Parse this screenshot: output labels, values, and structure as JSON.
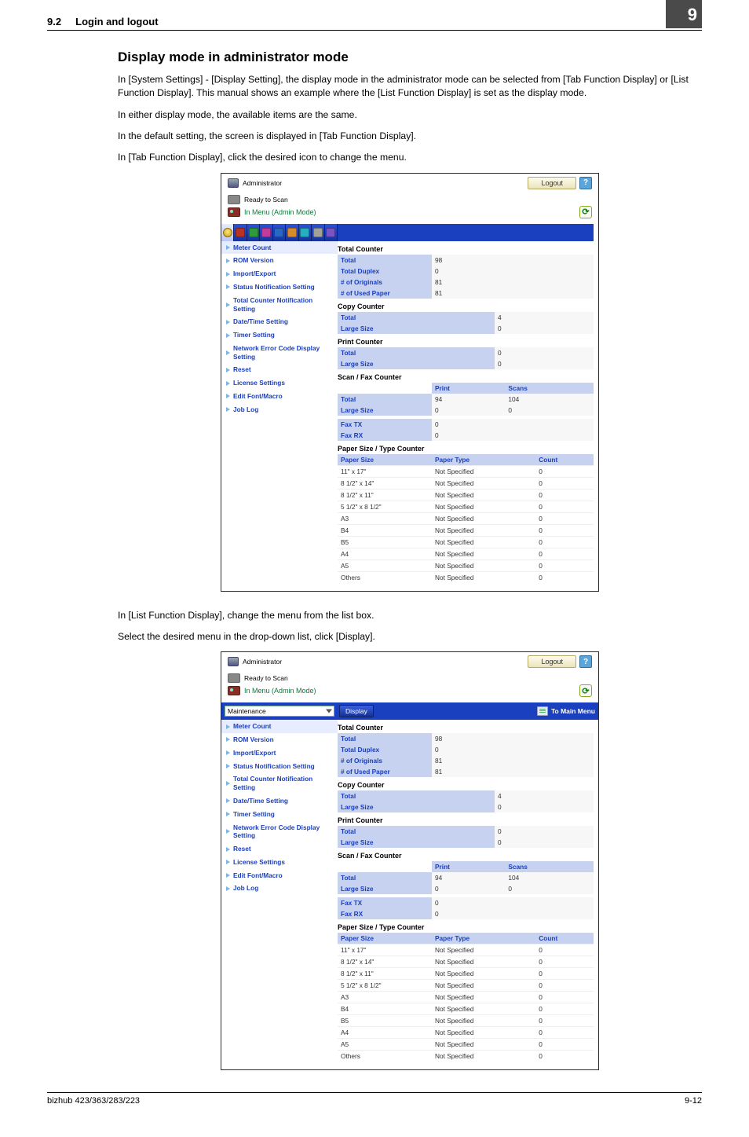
{
  "section": {
    "number": "9.2",
    "title": "Login and logout",
    "chapter": "9"
  },
  "h2": "Display mode in administrator mode",
  "paragraphs": {
    "p1": "In [System Settings] - [Display Setting], the display mode in the administrator mode can be selected from [Tab Function Display] or [List Function Display]. This manual shows an example where the [List Function Display] is set as the display mode.",
    "p2": "In either display mode, the available items are the same.",
    "p3": "In the default setting, the screen is displayed in [Tab Function Display].",
    "p4": "In [Tab Function Display], click the desired icon to change the menu.",
    "p5": "In [List Function Display], change the menu from the list box.",
    "p6": "Select the desired menu in the drop-down list, click [Display]."
  },
  "screenshot_common": {
    "admin_label": "Administrator",
    "logout": "Logout",
    "help": "?",
    "ready": "Ready to Scan",
    "menu_mode": "In Menu (Admin Mode)",
    "sidebar": [
      "Meter Count",
      "ROM Version",
      "Import/Export",
      "Status Notification Setting",
      "Total Counter Notification Setting",
      "Date/Time Setting",
      "Timer Setting",
      "Network Error Code Display Setting",
      "Reset",
      "License Settings",
      "Edit Font/Macro",
      "Job Log"
    ],
    "sections": {
      "total_counter_title": "Total Counter",
      "total_counter": [
        [
          "Total",
          "98"
        ],
        [
          "Total Duplex",
          "0"
        ],
        [
          "# of Originals",
          "81"
        ],
        [
          "# of Used Paper",
          "81"
        ]
      ],
      "copy_counter_title": "Copy Counter",
      "copy_counter": [
        [
          "Total",
          "4"
        ],
        [
          "Large Size",
          "0"
        ]
      ],
      "print_counter_title": "Print Counter",
      "print_counter": [
        [
          "Total",
          "0"
        ],
        [
          "Large Size",
          "0"
        ]
      ],
      "scan_fax_title": "Scan / Fax Counter",
      "scan_fax_headers": [
        "",
        "Print",
        "Scans"
      ],
      "scan_fax_rows": [
        [
          "Total",
          "94",
          "104"
        ],
        [
          "Large Size",
          "0",
          "0"
        ]
      ],
      "fax_rows": [
        [
          "Fax TX",
          "0"
        ],
        [
          "Fax RX",
          "0"
        ]
      ],
      "paper_title": "Paper Size / Type Counter",
      "paper_headers": [
        "Paper Size",
        "Paper Type",
        "Count"
      ],
      "paper_rows": [
        [
          "11\" x 17\"",
          "Not Specified",
          "0"
        ],
        [
          "8 1/2\" x 14\"",
          "Not Specified",
          "0"
        ],
        [
          "8 1/2\" x 11\"",
          "Not Specified",
          "0"
        ],
        [
          "5 1/2\" x 8 1/2\"",
          "Not Specified",
          "0"
        ],
        [
          "A3",
          "Not Specified",
          "0"
        ],
        [
          "B4",
          "Not Specified",
          "0"
        ],
        [
          "B5",
          "Not Specified",
          "0"
        ],
        [
          "A4",
          "Not Specified",
          "0"
        ],
        [
          "A5",
          "Not Specified",
          "0"
        ],
        [
          "Others",
          "Not Specified",
          "0"
        ]
      ]
    }
  },
  "screenshot2": {
    "dropdown": "Maintenance",
    "display_btn": "Display",
    "to_main": "To Main Menu"
  },
  "footer": {
    "left": "bizhub 423/363/283/223",
    "right": "9-12"
  }
}
